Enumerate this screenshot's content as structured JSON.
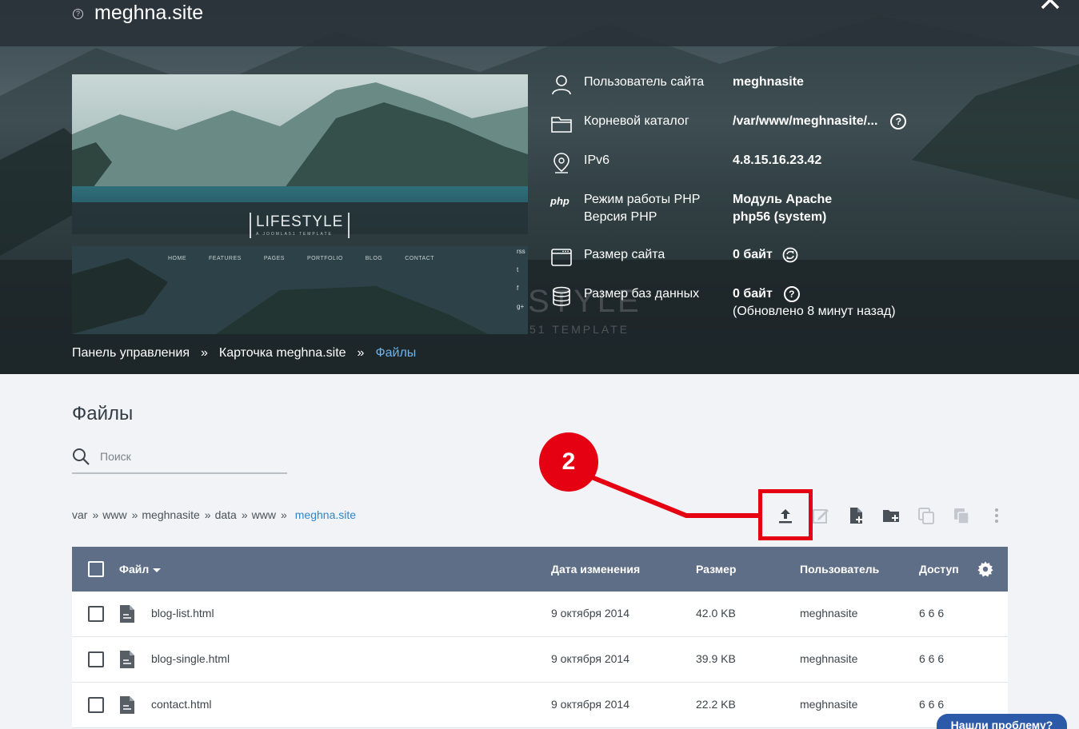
{
  "header": {
    "site_title": "meghna.site",
    "help_dot": "?",
    "close_icon": "close-icon"
  },
  "preview": {
    "logo_text": "LIFESTYLE",
    "logo_sub": "A JOOMLA51 TEMPLATE",
    "menu": [
      "HOME",
      "FEATURES",
      "PAGES",
      "PORTFOLIO",
      "BLOG",
      "CONTACT"
    ],
    "social": [
      "rss",
      "t",
      "f",
      "g+"
    ],
    "ghost_text": "STYLE",
    "ghost_sub": "51 TEMPLATE"
  },
  "site_info": {
    "user_label": "Пользователь сайта",
    "user_value": "meghnasite",
    "root_label": "Корневой каталог",
    "root_value": "/var/www/meghnasite/...",
    "ip_label": "IPv6",
    "ip_value": "4.8.15.16.23.42",
    "php_mode_label": "Режим работы PHP",
    "php_version_label": "Версия PHP",
    "php_mode_value": "Модуль Apache",
    "php_version_value": "php56 (system)",
    "php_icon_text": "php",
    "size_label": "Размер сайта",
    "size_value": "0 байт",
    "db_label": "Размер баз данных",
    "db_value": "0 байт",
    "db_updated": "(Обновлено 8 минут назад)",
    "help_glyph": "?"
  },
  "breadcrumb": {
    "items": [
      "Панель управления",
      "Карточка meghna.site",
      "Файлы"
    ],
    "separator": "»"
  },
  "main": {
    "title": "Файлы",
    "search_placeholder": "Поиск"
  },
  "path": {
    "segments": [
      "var",
      "www",
      "meghnasite",
      "data",
      "www",
      "meghna.site"
    ],
    "separator": "»"
  },
  "toolbar": {
    "tools": [
      "upload-icon",
      "edit-icon",
      "new-file-icon",
      "new-folder-icon",
      "copy-icon",
      "paste-icon",
      "more-vertical-icon"
    ]
  },
  "annotation": {
    "badge": "2"
  },
  "table": {
    "columns": {
      "file": "Файл",
      "modified": "Дата изменения",
      "size": "Размер",
      "user": "Пользователь",
      "access": "Доступ"
    },
    "rows": [
      {
        "name": "blog-list.html",
        "modified": "9 октября 2014",
        "size": "42.0 KB",
        "user": "meghnasite",
        "access": "6 6 6"
      },
      {
        "name": "blog-single.html",
        "modified": "9 октября 2014",
        "size": "39.9 KB",
        "user": "meghnasite",
        "access": "6 6 6"
      },
      {
        "name": "contact.html",
        "modified": "9 октября 2014",
        "size": "22.2 KB",
        "user": "meghnasite",
        "access": "6 6 6"
      }
    ]
  },
  "help_tab": {
    "label": "Нашли проблему?"
  },
  "colors": {
    "accent": "#2f86c9",
    "table_header": "#5f6e87",
    "annotation": "#e50012",
    "help_tab": "#2d5aa8"
  }
}
